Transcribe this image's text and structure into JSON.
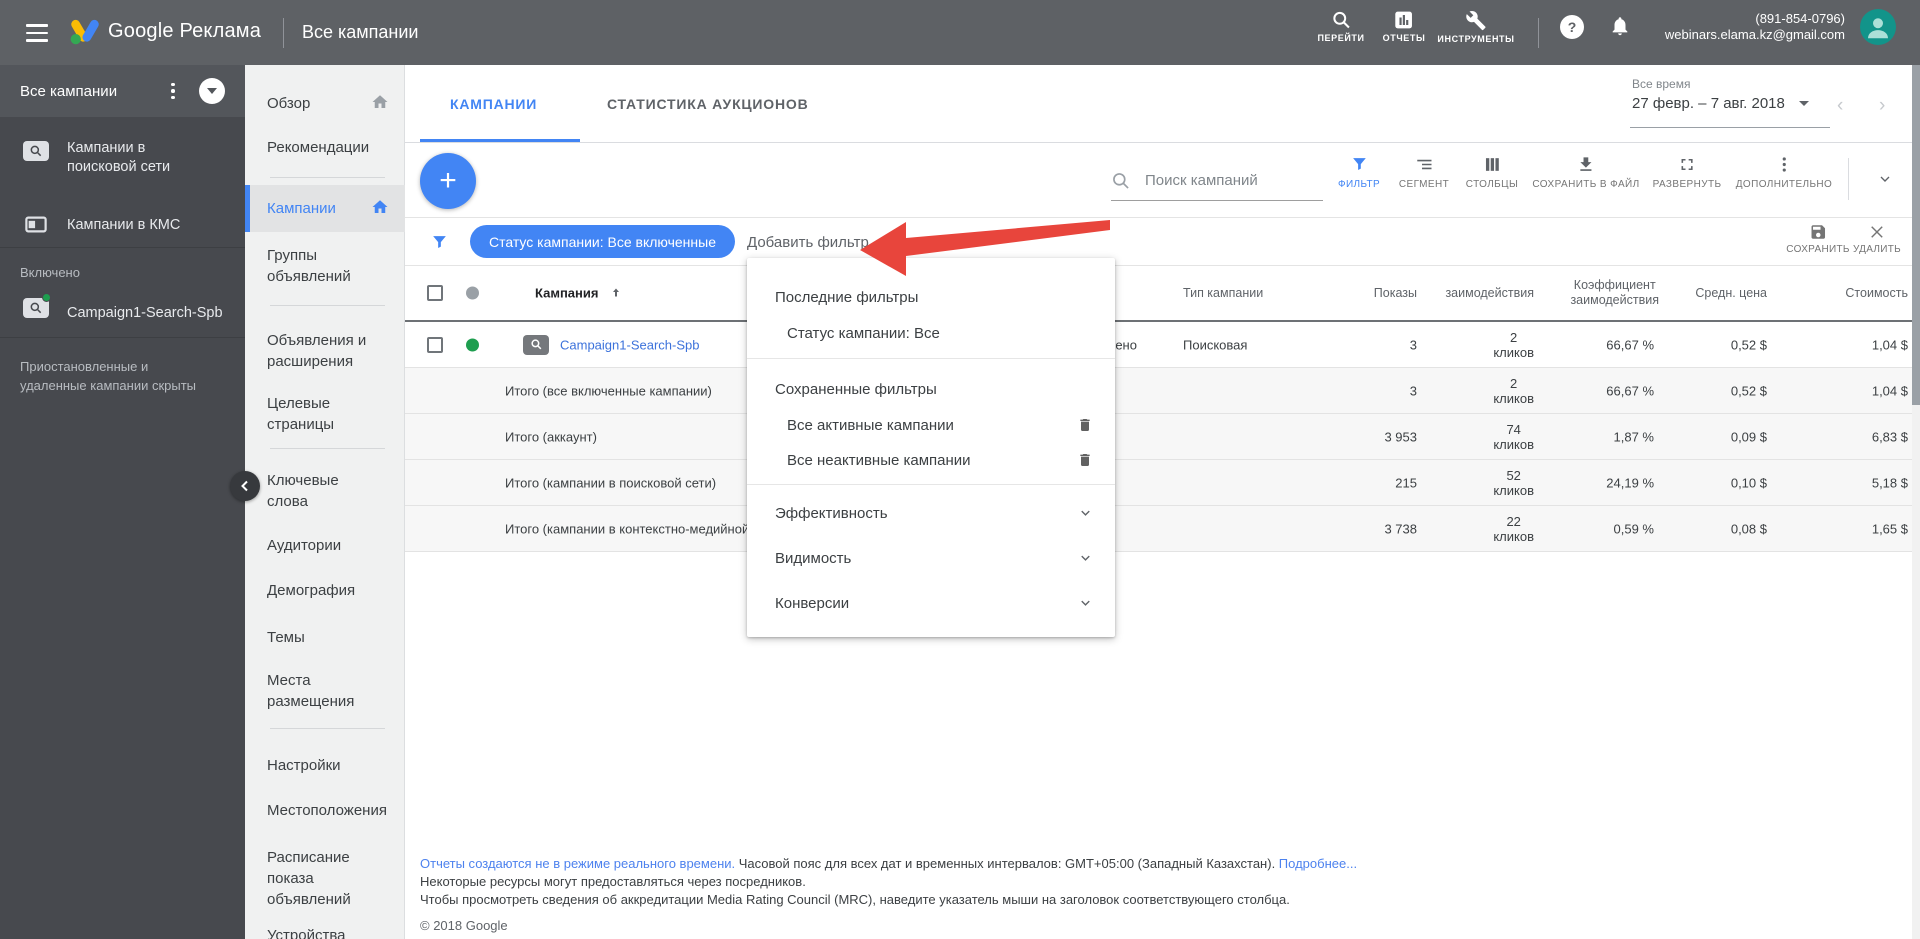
{
  "colors": {
    "accent": "#4285f4",
    "topbar": "#5e6165",
    "sidebar_dark": "#47494e",
    "status_green": "#1e9e4f",
    "arrow_red": "#e8453c",
    "link_blue": "#3c72db"
  },
  "topbar": {
    "brand": "Google Реклама",
    "title": "Все кампании",
    "goto_label": "ПЕРЕЙТИ",
    "reports_label": "ОТЧЕТЫ",
    "tools_label": "ИНСТРУМЕНТЫ",
    "phone": "(891-854-0796)",
    "email": "webinars.elama.kz@gmail.com"
  },
  "campaign_tree": {
    "title": "Все кампании",
    "search_campaigns": "Кампании в поисковой сети",
    "display_campaigns": "Кампании в КМС",
    "enabled_label": "Включено",
    "campaign_name": "Campaign1-Search-Spb",
    "hidden_note": "Приостановленные и удаленные кампании скрыты"
  },
  "nav": {
    "items": [
      {
        "label": "Обзор"
      },
      {
        "label": "Рекомендации"
      },
      {
        "label": "Кампании"
      },
      {
        "label": "Группы объявлений"
      },
      {
        "label": "Объявления и расширения"
      },
      {
        "label": "Целевые страницы"
      },
      {
        "label": "Ключевые слова"
      },
      {
        "label": "Аудитории"
      },
      {
        "label": "Демография"
      },
      {
        "label": "Темы"
      },
      {
        "label": "Места размещения"
      },
      {
        "label": "Настройки"
      },
      {
        "label": "Местоположения"
      },
      {
        "label": "Расписание показа объявлений"
      },
      {
        "label": "Устройства"
      }
    ]
  },
  "tabs": {
    "campaigns": "КАМПАНИИ",
    "auction": "СТАТИСТИКА АУКЦИОНОВ"
  },
  "daterange": {
    "preset": "Все время",
    "value": "27 февр. – 7 авг. 2018"
  },
  "toolbar": {
    "search_placeholder": "Поиск кампаний",
    "filter": "ФИЛЬТР",
    "segment": "СЕГМЕНТ",
    "columns": "СТОЛБЦЫ",
    "download": "СОХРАНИТЬ В ФАЙЛ",
    "expand": "РАЗВЕРНУТЬ",
    "more": "ДОПОЛНИТЕЛЬНО"
  },
  "filterbar": {
    "chip": "Статус кампании: Все включенные",
    "add_filter": "Добавить фильтр",
    "save": "СОХРАНИТЬ",
    "remove": "УДАЛИТЬ"
  },
  "filter_menu": {
    "recent_header": "Последние фильтры",
    "recent_item": "Статус кампании: Все",
    "saved_header": "Сохраненные фильтры",
    "saved_item1": "Все активные кампании",
    "saved_item2": "Все неактивные кампании",
    "cat1": "Эффективность",
    "cat2": "Видимость",
    "cat3": "Конверсии"
  },
  "table": {
    "headers": {
      "campaign": "Кампания",
      "type": "Тип кампании",
      "impressions": "Показы",
      "interactions": "заимодействия",
      "rate1": "Коэффициент",
      "rate2": "заимодействия",
      "avg_cpc": "Средн. цена",
      "cost": "Стоимость"
    },
    "rows": [
      {
        "name": "Campaign1-Search-Spb",
        "status": "Включено",
        "type": "Поисковая",
        "impressions": "3",
        "inter": "2",
        "unit": "кликов",
        "rate": "66,67 %",
        "avg": "0,52 $",
        "cost": "1,04 $"
      },
      {
        "name": "Итого (все включенные кампании)",
        "impressions": "3",
        "inter": "2",
        "unit": "кликов",
        "rate": "66,67 %",
        "avg": "0,52 $",
        "cost": "1,04 $"
      },
      {
        "name": "Итого (аккаунт)",
        "impressions": "3 953",
        "inter": "74",
        "unit": "кликов",
        "rate": "1,87 %",
        "avg": "0,09 $",
        "cost": "6,83 $"
      },
      {
        "name": "Итого (кампании в поисковой сети)",
        "impressions": "215",
        "inter": "52",
        "unit": "кликов",
        "rate": "24,19 %",
        "avg": "0,10 $",
        "cost": "5,18 $"
      },
      {
        "name": "Итого (кампании в контекстно-медийной сети)",
        "impressions": "3 738",
        "inter": "22",
        "unit": "кликов",
        "rate": "0,59 %",
        "avg": "0,08 $",
        "cost": "1,65 $"
      }
    ]
  },
  "footer": {
    "line1_link": "Отчеты создаются не в режиме реального времени.",
    "line1_text": " Часовой пояс для всех дат и временных интервалов: GMT+05:00 (Западный Казахстан). ",
    "line1_more": "Подробнее...",
    "line2": "Некоторые ресурсы могут предоставляться через посредников.",
    "line3": "Чтобы просмотреть сведения об аккредитации Media Rating Council (MRC), наведите указатель мыши на заголовок соответствующего столбца.",
    "copyright": "© 2018 Google"
  }
}
